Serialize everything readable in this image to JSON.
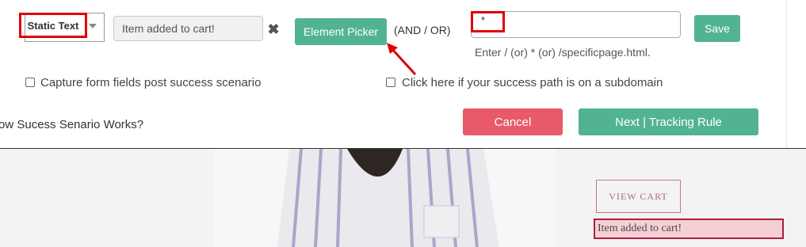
{
  "config": {
    "selector_type": "Static Text",
    "selector_value": "Item added to cart!",
    "element_picker_label": "Element Picker",
    "and_or_label": "(AND / OR)",
    "url_value": "*",
    "save_label": "Save",
    "url_hint": "Enter / (or) * (or) /specificpage.html.",
    "capture_fields_label": "Capture form fields post success scenario",
    "subdomain_label": "Click here if your success path is on a subdomain",
    "how_it_works_label": "ow Sucess Senario Works?",
    "cancel_label": "Cancel",
    "next_label": "Next | Tracking Rule"
  },
  "preview": {
    "view_cart_label": "VIEW CART",
    "cart_message": "Item added to cart!"
  },
  "colors": {
    "accent_green": "#52b394",
    "cancel_red": "#e85a69",
    "highlight_red": "#e00000",
    "cart_message_bg": "#f6cfd6"
  }
}
